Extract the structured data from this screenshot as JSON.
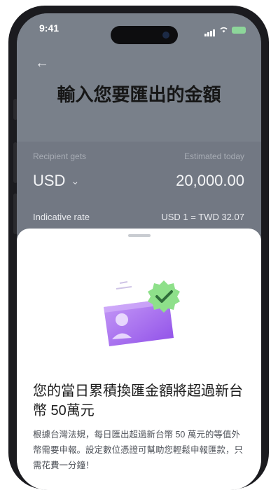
{
  "status_bar": {
    "time": "9:41"
  },
  "header": {
    "title": "輸入您要匯出的金額"
  },
  "quote": {
    "recipient_label": "Recipient gets",
    "estimated_label": "Estimated today",
    "currency": "USD",
    "amount": "20,000.00",
    "rate_label": "Indicative rate",
    "rate_value": "USD 1 = TWD 32.07"
  },
  "sheet": {
    "title": "您的當日累積換匯金額將超過新台幣 50萬元",
    "body": "根據台灣法規，每日匯出超過新台幣 50 萬元的等值外幣需要申報。設定數位憑證可幫助您輕鬆申報匯款，只需花費一分鐘！"
  },
  "colors": {
    "accent_green": "#8ee08a",
    "card_purple": "#a566ef"
  }
}
